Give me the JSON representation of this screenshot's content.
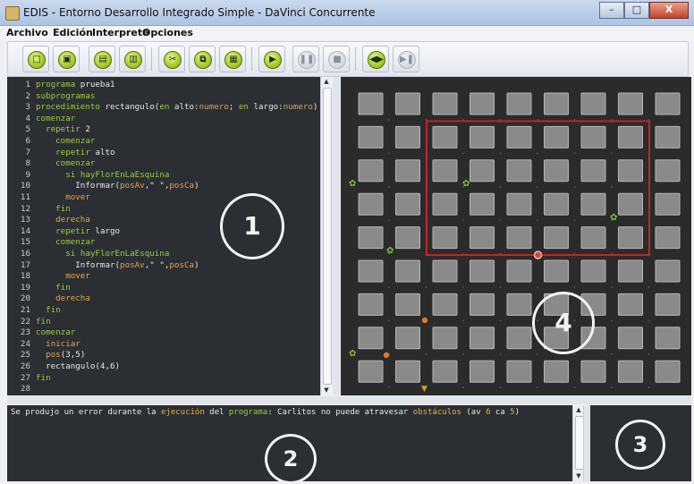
{
  "window": {
    "title": "EDIS - Entorno Desarrollo Integrado Simple - DaVinci Concurrente",
    "minimize": "–",
    "maximize": "□",
    "close": "X"
  },
  "menu": [
    "Archivo",
    "Edición",
    "Interprete",
    "Opciones"
  ],
  "toolbar": {
    "buttons": [
      {
        "name": "new-file-icon",
        "glyph": "□",
        "enabled": true
      },
      {
        "name": "new-window-icon",
        "glyph": "▣",
        "enabled": true
      },
      {
        "name": "open-file-icon",
        "glyph": "▤",
        "enabled": true
      },
      {
        "name": "save-file-icon",
        "glyph": "▥",
        "enabled": true
      },
      {
        "name": "cut-icon",
        "glyph": "✂",
        "enabled": true
      },
      {
        "name": "copy-icon",
        "glyph": "⧉",
        "enabled": true
      },
      {
        "name": "paste-icon",
        "glyph": "▦",
        "enabled": true
      },
      {
        "name": "run-icon",
        "glyph": "▶",
        "enabled": true
      },
      {
        "name": "pause-icon",
        "glyph": "❚❚",
        "enabled": false
      },
      {
        "name": "stop-icon",
        "glyph": "■",
        "enabled": false
      },
      {
        "name": "step-icon",
        "glyph": "◀▶",
        "enabled": true
      },
      {
        "name": "step-next-icon",
        "glyph": "▶❚",
        "enabled": false
      }
    ]
  },
  "editor": {
    "lines": [
      {
        "n": "1",
        "parts": [
          {
            "t": "programa",
            "c": "kw"
          },
          {
            "t": " prueba1",
            "c": "tx"
          }
        ]
      },
      {
        "n": "2",
        "parts": [
          {
            "t": "subprogramas",
            "c": "kw"
          }
        ]
      },
      {
        "n": "3",
        "parts": [
          {
            "t": "procedimiento",
            "c": "kw"
          },
          {
            "t": " rectangulo(",
            "c": "tx"
          },
          {
            "t": "en",
            "c": "kw"
          },
          {
            "t": " alto:",
            "c": "tx"
          },
          {
            "t": "numero",
            "c": "ty"
          },
          {
            "t": "; ",
            "c": "tx"
          },
          {
            "t": "en",
            "c": "kw"
          },
          {
            "t": " largo:",
            "c": "tx"
          },
          {
            "t": "numero",
            "c": "ty"
          },
          {
            "t": ")",
            "c": "tx"
          }
        ]
      },
      {
        "n": "4",
        "parts": [
          {
            "t": "comenzar",
            "c": "kw"
          }
        ]
      },
      {
        "n": "5",
        "parts": [
          {
            "t": "  ",
            "c": "tx"
          },
          {
            "t": "repetir",
            "c": "kw"
          },
          {
            "t": " 2",
            "c": "tx"
          }
        ]
      },
      {
        "n": "6",
        "parts": [
          {
            "t": "    ",
            "c": "tx"
          },
          {
            "t": "comenzar",
            "c": "kw"
          }
        ]
      },
      {
        "n": "7",
        "parts": [
          {
            "t": "    ",
            "c": "tx"
          },
          {
            "t": "repetir",
            "c": "kw"
          },
          {
            "t": " alto",
            "c": "tx"
          }
        ]
      },
      {
        "n": "8",
        "parts": [
          {
            "t": "    ",
            "c": "tx"
          },
          {
            "t": "comenzar",
            "c": "kw"
          }
        ]
      },
      {
        "n": "9",
        "parts": [
          {
            "t": "      ",
            "c": "tx"
          },
          {
            "t": "si",
            "c": "kw"
          },
          {
            "t": " ",
            "c": "tx"
          },
          {
            "t": "hayFlorEnLaEsquina",
            "c": "kw"
          }
        ]
      },
      {
        "n": "10",
        "parts": [
          {
            "t": "        Informar(",
            "c": "tx"
          },
          {
            "t": "posAv",
            "c": "ac"
          },
          {
            "t": ",\" \",",
            "c": "tx"
          },
          {
            "t": "posCa",
            "c": "ac"
          },
          {
            "t": ")",
            "c": "tx"
          }
        ]
      },
      {
        "n": "11",
        "parts": [
          {
            "t": "      ",
            "c": "tx"
          },
          {
            "t": "mover",
            "c": "ac"
          }
        ]
      },
      {
        "n": "12",
        "parts": [
          {
            "t": "    ",
            "c": "tx"
          },
          {
            "t": "fin",
            "c": "kw"
          }
        ]
      },
      {
        "n": "13",
        "parts": [
          {
            "t": "    ",
            "c": "tx"
          },
          {
            "t": "derecha",
            "c": "ac"
          }
        ]
      },
      {
        "n": "14",
        "parts": [
          {
            "t": "    ",
            "c": "tx"
          },
          {
            "t": "repetir",
            "c": "kw"
          },
          {
            "t": " largo",
            "c": "tx"
          }
        ]
      },
      {
        "n": "15",
        "parts": [
          {
            "t": "    ",
            "c": "tx"
          },
          {
            "t": "comenzar",
            "c": "kw"
          }
        ]
      },
      {
        "n": "16",
        "parts": [
          {
            "t": "      ",
            "c": "tx"
          },
          {
            "t": "si",
            "c": "kw"
          },
          {
            "t": " ",
            "c": "tx"
          },
          {
            "t": "hayFlorEnLaEsquina",
            "c": "kw"
          }
        ]
      },
      {
        "n": "17",
        "parts": [
          {
            "t": "        Informar(",
            "c": "tx"
          },
          {
            "t": "posAv",
            "c": "ac"
          },
          {
            "t": ",\" \",",
            "c": "tx"
          },
          {
            "t": "posCa",
            "c": "ac"
          },
          {
            "t": ")",
            "c": "tx"
          }
        ]
      },
      {
        "n": "18",
        "parts": [
          {
            "t": "      ",
            "c": "tx"
          },
          {
            "t": "mover",
            "c": "ac"
          }
        ]
      },
      {
        "n": "19",
        "parts": [
          {
            "t": "    ",
            "c": "tx"
          },
          {
            "t": "fin",
            "c": "kw"
          }
        ]
      },
      {
        "n": "20",
        "parts": [
          {
            "t": "    ",
            "c": "tx"
          },
          {
            "t": "derecha",
            "c": "ac"
          }
        ]
      },
      {
        "n": "21",
        "parts": [
          {
            "t": "  ",
            "c": "tx"
          },
          {
            "t": "fin",
            "c": "kw"
          }
        ]
      },
      {
        "n": "22",
        "parts": [
          {
            "t": "fin",
            "c": "kw"
          }
        ]
      },
      {
        "n": "23",
        "parts": [
          {
            "t": "comenzar",
            "c": "kw"
          }
        ]
      },
      {
        "n": "24",
        "parts": [
          {
            "t": "  ",
            "c": "tx"
          },
          {
            "t": "iniciar",
            "c": "ac"
          }
        ]
      },
      {
        "n": "25",
        "parts": [
          {
            "t": "  ",
            "c": "tx"
          },
          {
            "t": "pos",
            "c": "ac"
          },
          {
            "t": "(3,5)",
            "c": "tx"
          }
        ]
      },
      {
        "n": "26",
        "parts": [
          {
            "t": "  rectangulo(4,6)",
            "c": "tx"
          }
        ]
      },
      {
        "n": "27",
        "parts": [
          {
            "t": "fin",
            "c": "kw"
          }
        ]
      },
      {
        "n": "28",
        "parts": []
      }
    ]
  },
  "console": {
    "parts": [
      {
        "t": "Se produjo un error durante la ",
        "c": "tx"
      },
      {
        "t": "ejecución",
        "c": "ty"
      },
      {
        "t": " del ",
        "c": "tx"
      },
      {
        "t": "programa",
        "c": "kw"
      },
      {
        "t": ": Carlitos no puede atravesar ",
        "c": "tx"
      },
      {
        "t": "obstáculos",
        "c": "ty"
      },
      {
        "t": " (av ",
        "c": "tx"
      },
      {
        "t": "6",
        "c": "ty"
      },
      {
        "t": " ca ",
        "c": "tx"
      },
      {
        "t": "5",
        "c": "ty"
      },
      {
        "t": ")",
        "c": "tx"
      }
    ]
  },
  "city": {
    "cols": 9,
    "rows": 9,
    "path_color": "#c0262a",
    "block_color": "#8a8a8a"
  },
  "markers": [
    "1",
    "2",
    "3",
    "4"
  ]
}
